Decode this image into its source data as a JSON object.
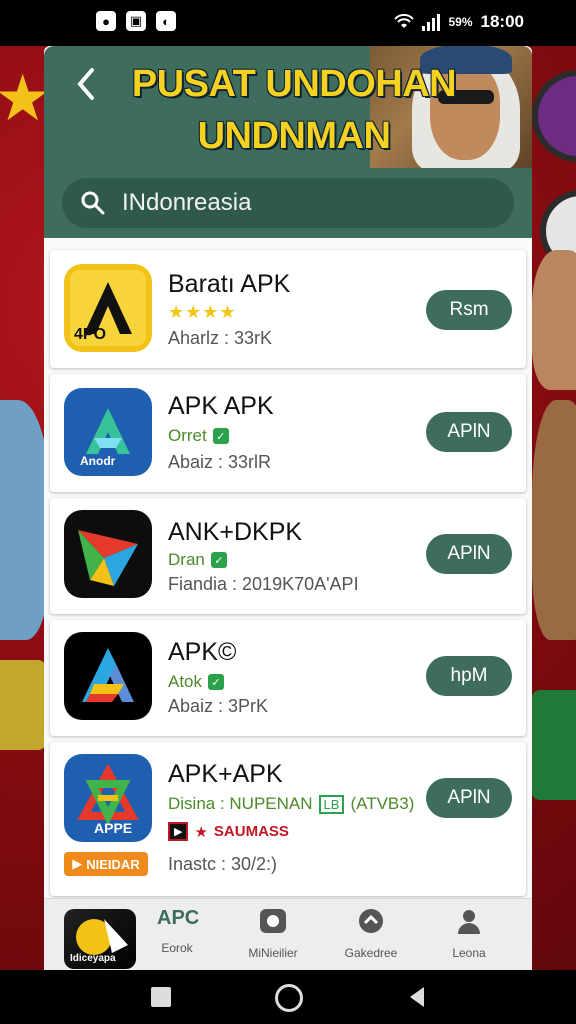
{
  "status_bar": {
    "time": "18:00",
    "battery": "59%",
    "left_icons": [
      "notification-icon",
      "gallery-icon",
      "app-icon"
    ]
  },
  "header": {
    "title_line1": "PUSAT UNDOHAN",
    "title_line2": "UNDNMAN INONISIA",
    "back_icon": "back-arrow-icon"
  },
  "search": {
    "value": "INdonreasia",
    "icon": "search-icon"
  },
  "apps": [
    {
      "name": "Baratı APK",
      "meta": "★★★★",
      "downloads": "Aharlz : 33rK",
      "button": "Rsm",
      "icon_label": "4PO"
    },
    {
      "name": "APK APK",
      "meta": "Orret",
      "downloads": "Abaiz : 33rlR",
      "button": "APlN",
      "icon_label": "Anodr"
    },
    {
      "name": "ANK+DKPK",
      "meta": "Dran",
      "downloads": "Fiandia : 2019K70A'API",
      "button": "APlN",
      "icon_label": ""
    },
    {
      "name": "APK©",
      "meta": "Atok",
      "downloads": "Abaiz : 3PrK",
      "button": "hpM",
      "icon_label": ""
    },
    {
      "name": "APK+APK",
      "meta": "Disina : NUPENAN",
      "meta_badge": "LB",
      "meta_extra": "(ATVB3)",
      "promo": "SAUMASS",
      "downloads": "Inastc : 30/2:)",
      "button": "APlN",
      "icon_label": "APPE",
      "tag": "NIEIDAR"
    }
  ],
  "bottom_nav": [
    {
      "label": "Idiceyapa"
    },
    {
      "label": "Eorok"
    },
    {
      "label": "MiNieilier"
    },
    {
      "label": "Gakedree"
    },
    {
      "label": "Leona"
    }
  ],
  "colors": {
    "accent": "#3e6d5d",
    "title": "#f4d21f",
    "background": "#8c0f14"
  }
}
